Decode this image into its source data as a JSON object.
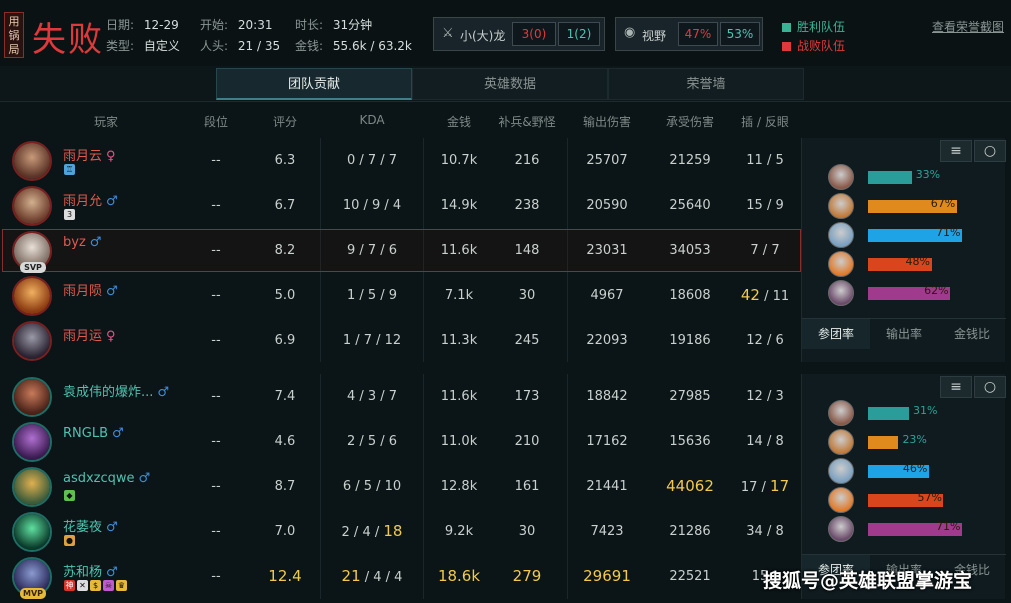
{
  "header": {
    "badge": "用锅局",
    "result": "失败",
    "date_label": "日期:",
    "date": "12-29",
    "type_label": "类型:",
    "type": "自定义",
    "start_label": "开始:",
    "start": "20:31",
    "kills_label": "人头:",
    "kills": "21 / 35",
    "duration_label": "时长:",
    "duration": "31分钟",
    "gold_label": "金钱:",
    "gold": "55.6k / 63.2k",
    "dragon_label": "小(大)龙",
    "dragon_ours": "3(0)",
    "dragon_theirs": "1(2)",
    "vision_label": "视野",
    "vision_ours": "47%",
    "vision_theirs": "53%",
    "legend_win": "胜利队伍",
    "legend_lose": "战败队伍",
    "link": "查看荣誉截图",
    "colors": {
      "win": "#3ab394",
      "lose": "#e0393b"
    }
  },
  "tabs": [
    "团队贡献",
    "英雄数据",
    "荣誉墙"
  ],
  "columns": [
    "玩家",
    "段位",
    "评分",
    "KDA",
    "金钱",
    "补兵&野怪",
    "输出伤害",
    "承受伤害",
    "插 / 反眼"
  ],
  "red_team": [
    {
      "name": "雨月云",
      "sex": "♀",
      "rank": "--",
      "score": "6.3",
      "kda": "0 / 7 / 7",
      "gold": "10.7k",
      "cs": "216",
      "dmg": "25707",
      "taken": "21259",
      "wards": "11 / 5"
    },
    {
      "name": "雨月允",
      "sex": "♂",
      "rank": "--",
      "score": "6.7",
      "kda": "10 / 9 / 4",
      "gold": "14.9k",
      "cs": "238",
      "dmg": "20590",
      "taken": "25640",
      "wards": "15 / 9"
    },
    {
      "name": "byz",
      "sex": "♂",
      "badge": "SVP",
      "rank": "--",
      "score": "8.2",
      "kda": "9 / 7 / 6",
      "gold": "11.6k",
      "cs": "148",
      "dmg": "23031",
      "taken": "34053",
      "wards": "7 / 7"
    },
    {
      "name": "雨月陨",
      "sex": "♂",
      "rank": "--",
      "score": "5.0",
      "kda": "1 / 5 / 9",
      "gold": "7.1k",
      "cs": "30",
      "dmg": "4967",
      "taken": "18608",
      "wards_hi": "42",
      "wards_rest": " / 11"
    },
    {
      "name": "雨月运",
      "sex": "♀",
      "rank": "--",
      "score": "6.9",
      "kda": "1 / 7 / 12",
      "gold": "11.3k",
      "cs": "245",
      "dmg": "22093",
      "taken": "19186",
      "wards": "12 / 6"
    }
  ],
  "blue_team": [
    {
      "name": "袁成伟的爆炸...",
      "sex": "♂",
      "rank": "--",
      "score": "7.4",
      "kda": "4 / 3 / 7",
      "gold": "11.6k",
      "cs": "173",
      "dmg": "18842",
      "taken": "27985",
      "wards": "12 / 3"
    },
    {
      "name": "RNGLB",
      "sex": "♂",
      "rank": "--",
      "score": "4.6",
      "kda": "2 / 5 / 6",
      "gold": "11.0k",
      "cs": "210",
      "dmg": "17162",
      "taken": "15636",
      "wards": "14 / 8"
    },
    {
      "name": "asdxzcqwe",
      "sex": "♂",
      "rank": "--",
      "score": "8.7",
      "kda": "6 / 5 / 10",
      "gold": "12.8k",
      "cs": "161",
      "dmg": "21441",
      "taken": "44062",
      "wards_pre": "17 / ",
      "wards_hi2": "17"
    },
    {
      "name": "花萎夜",
      "sex": "♂",
      "rank": "--",
      "score": "7.0",
      "kda_pre": "2 / 4 / ",
      "kda_hi2": "18",
      "gold": "9.2k",
      "cs": "30",
      "dmg": "7423",
      "taken": "21286",
      "wards": "34 / 8"
    },
    {
      "name": "苏和杨",
      "sex": "♂",
      "badge": "MVP",
      "rank": "--",
      "score": "12.4",
      "kda_hi": "21",
      "kda_rest": " / 4 / 4",
      "gold": "18.6k",
      "cs": "279",
      "dmg": "29691",
      "taken": "22521",
      "wards": "15"
    }
  ],
  "red_panel": {
    "bars": [
      {
        "pct": "33%",
        "value": 33,
        "color": "#2a9d9a"
      },
      {
        "pct": "67%",
        "value": 67,
        "color": "#e08a1e"
      },
      {
        "pct": "71%",
        "value": 71,
        "color": "#1ea3e6"
      },
      {
        "pct": "48%",
        "value": 48,
        "color": "#d9461e"
      },
      {
        "pct": "62%",
        "value": 62,
        "color": "#a03a8c"
      }
    ],
    "tabs": [
      "参团率",
      "输出率",
      "金钱比"
    ]
  },
  "blue_panel": {
    "bars": [
      {
        "pct": "31%",
        "value": 31,
        "color": "#2a9d9a"
      },
      {
        "pct": "23%",
        "value": 23,
        "color": "#e08a1e"
      },
      {
        "pct": "46%",
        "value": 46,
        "color": "#1ea3e6"
      },
      {
        "pct": "57%",
        "value": 57,
        "color": "#d9461e"
      },
      {
        "pct": "71%",
        "value": 71,
        "color": "#a03a8c"
      }
    ],
    "tabs": [
      "参团率",
      "输出率",
      "金钱比"
    ]
  },
  "watermark": "搜狐号@英雄联盟掌游宝"
}
